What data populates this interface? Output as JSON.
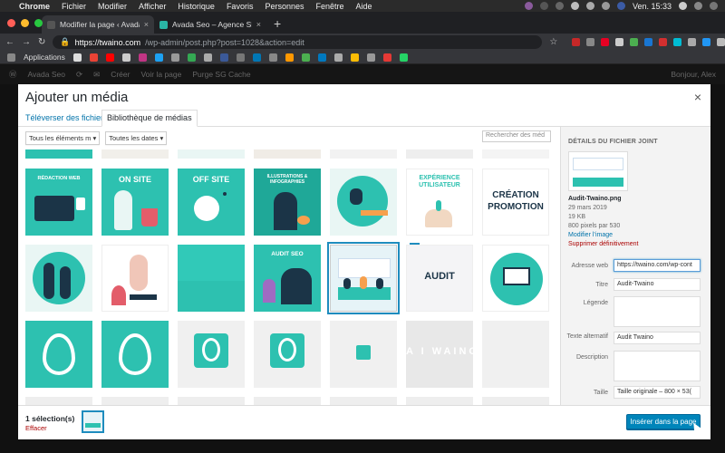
{
  "mac": {
    "app": "Chrome",
    "menus": [
      "Fichier",
      "Modifier",
      "Afficher",
      "Historique",
      "Favoris",
      "Personnes",
      "Fenêtre",
      "Aide"
    ],
    "clock": "Ven. 15:33"
  },
  "browser": {
    "tabs": [
      {
        "title": "Modifier la page ‹ Avada Seo – ",
        "favicon_color": "#555555"
      },
      {
        "title": "Avada Seo – Agence SEO",
        "favicon_color": "#2ab5a5"
      }
    ],
    "url_host": "https://twaino.com",
    "url_path": "/wp-admin/post.php?post=1028&action=edit",
    "bookmarks_label": "Applications"
  },
  "wpbar": {
    "site": "Avada Seo",
    "items": [
      "Créer",
      "Voir la page",
      "Purge SG Cache"
    ],
    "greeting": "Bonjour, Alex"
  },
  "modal": {
    "title": "Ajouter un média",
    "close": "×",
    "tabs": [
      "Téléverser des fichiers",
      "Bibliothèque de médias"
    ],
    "filters": [
      "Tous les éléments m",
      "Toutes les dates"
    ],
    "search_placeholder": "Rechercher des méd",
    "tiles": [
      {
        "label": "RÉDACTION WEB"
      },
      {
        "label": "ON SITE"
      },
      {
        "label": "OFF SITE"
      },
      {
        "label": "ILLUSTRATIONS & INFOGRAPHIES"
      },
      {
        "label": ""
      },
      {
        "label": "EXPÉRIENCE UTILISATEUR"
      },
      {
        "label": "CRÉATION PROMOTION"
      },
      {
        "label": ""
      },
      {
        "label": ""
      },
      {
        "label": ""
      },
      {
        "label": "AUDIT SEO"
      },
      {
        "label": ""
      },
      {
        "label": "AUDIT"
      },
      {
        "label": ""
      },
      {
        "label": ""
      },
      {
        "label": ""
      },
      {
        "label": ""
      },
      {
        "label": ""
      },
      {
        "label": ""
      },
      {
        "label": "A I WAINO"
      },
      {
        "label": ""
      }
    ],
    "details": {
      "heading": "DÉTAILS DU FICHIER JOINT",
      "filename": "Audit-Twaino.png",
      "date": "29 mars 2019",
      "size": "19 KB",
      "dimensions": "800 pixels par 530",
      "edit_link": "Modifier l’image",
      "delete_link": "Supprimer définitivement",
      "fields": [
        {
          "label": "Adresse web",
          "value": "https://twaino.com/wp-cont"
        },
        {
          "label": "Titre",
          "value": "Audit-Twaino"
        },
        {
          "label": "Légende",
          "value": ""
        },
        {
          "label": "Texte alternatif",
          "value": "Audit Twaino"
        },
        {
          "label": "Description",
          "value": ""
        },
        {
          "label": "Taille",
          "value": "Taille originale – 800 × 53("
        }
      ]
    },
    "footer": {
      "count": "1 sélection(s)",
      "clear": "Effacer",
      "insert": "Insérer dans la page"
    }
  },
  "colors": {
    "teal": "#2dc1b0",
    "wp_blue": "#0085ba"
  }
}
